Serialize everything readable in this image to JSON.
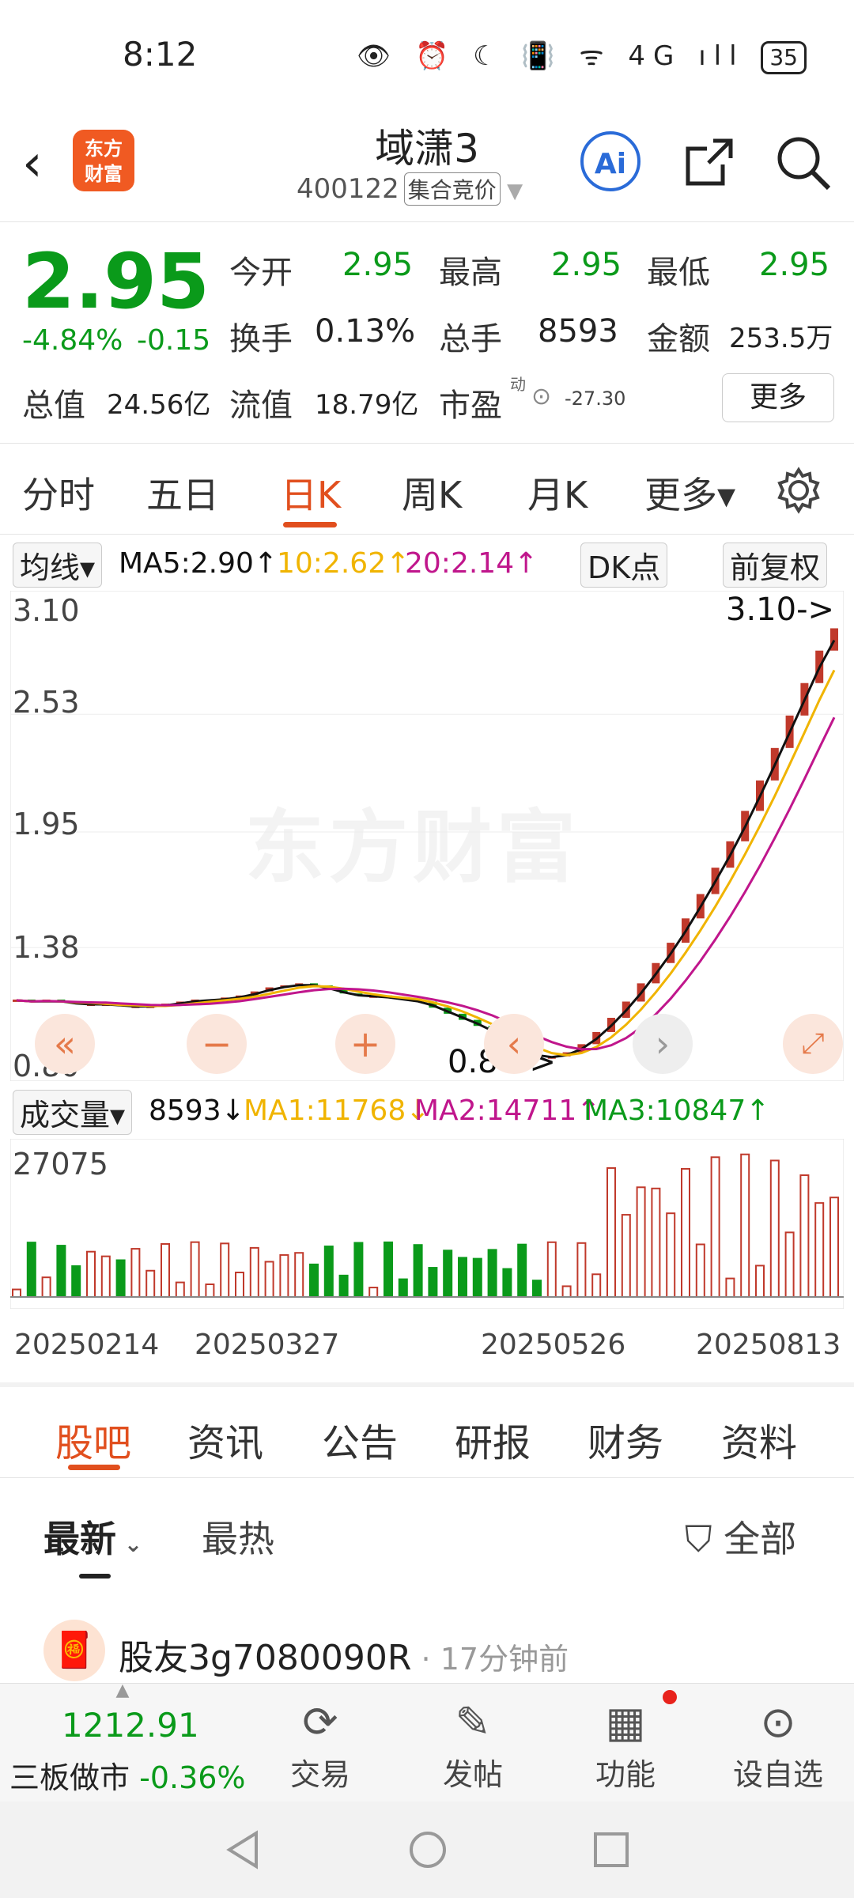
{
  "status": {
    "time": "8:12",
    "icons": "👁 ⏰ ☾ 📳 ᯤ 4G ıll",
    "battery": "35"
  },
  "header": {
    "stock_name": "域潇3",
    "stock_code": "400122",
    "auction_tag": "集合竞价"
  },
  "quote": {
    "price": "2.95",
    "change_pct": "-4.84%",
    "change_amt": "-0.15",
    "open_label": "今开",
    "open": "2.95",
    "high_label": "最高",
    "high": "2.95",
    "low_label": "最低",
    "low": "2.95",
    "turnover_label": "换手",
    "turnover": "0.13%",
    "volume_label": "总手",
    "volume": "8593",
    "amount_label": "金额",
    "amount": "253.5万",
    "total_value_label": "总值",
    "total_value": "24.56亿",
    "float_value_label": "流值",
    "float_value": "18.79亿",
    "pe_label": "市盈",
    "pe_sup": "动",
    "pe": "-27.30",
    "more": "更多"
  },
  "ktabs": [
    "分时",
    "五日",
    "日K",
    "周K",
    "月K",
    "更多▾"
  ],
  "ktab_active": "日K",
  "ma_row": {
    "selector": "均线▾",
    "ma5": "MA5:2.90↑",
    "ma10": "10:2.62↑",
    "ma20": "20:2.14↑",
    "dk": "DK点",
    "adjust": "前复权"
  },
  "price_axis": [
    "3.10",
    "2.53",
    "1.95",
    "1.38",
    "0.80"
  ],
  "annotations": {
    "high": "3.10->",
    "low": "0.80->"
  },
  "watermark": "东方财富",
  "volume_row": {
    "selector": "成交量▾",
    "vol": "8593↓",
    "ma1": "MA1:11768↓",
    "ma2": "MA2:14711↑",
    "ma3": "MA3:10847↑",
    "max": "27075"
  },
  "dates": [
    "20250214",
    "20250327",
    "20250526",
    "20250813"
  ],
  "bottom_tabs": [
    "股吧",
    "资讯",
    "公告",
    "研报",
    "财务",
    "资料"
  ],
  "sub_tabs": {
    "latest": "最新",
    "hot": "最热",
    "filter": "全部"
  },
  "post": {
    "user": "股友3g7080090R",
    "time": "17分钟前"
  },
  "bottom_bar": {
    "index_value": "1212.91",
    "index_name": "三板做市",
    "index_change": "-0.36%",
    "trade": "交易",
    "post": "发帖",
    "func": "功能",
    "watch": "设自选"
  },
  "colors": {
    "up": "#c0392b",
    "down": "#0a9a1a",
    "accent": "#e14f1e",
    "ma5": "#111111",
    "ma10": "#f0b400",
    "ma20": "#c0168c"
  },
  "chart_data": {
    "type": "candlestick",
    "price_range": [
      0.8,
      3.1
    ],
    "ma_current": {
      "MA5": 2.9,
      "MA10": 2.62,
      "MA20": 2.14
    },
    "close_series": [
      1.12,
      1.11,
      1.12,
      1.11,
      1.1,
      1.1,
      1.1,
      1.09,
      1.09,
      1.09,
      1.1,
      1.11,
      1.12,
      1.12,
      1.13,
      1.14,
      1.16,
      1.18,
      1.19,
      1.2,
      1.19,
      1.17,
      1.15,
      1.14,
      1.14,
      1.13,
      1.12,
      1.11,
      1.08,
      1.05,
      1.02,
      0.99,
      0.95,
      0.9,
      0.86,
      0.84,
      0.84,
      0.86,
      0.9,
      0.96,
      1.03,
      1.11,
      1.2,
      1.3,
      1.4,
      1.52,
      1.64,
      1.77,
      1.9,
      2.05,
      2.2,
      2.36,
      2.52,
      2.68,
      2.84,
      2.95
    ],
    "volume_max": 27075,
    "volume_last": 8593,
    "volume_ma": {
      "MA1": 11768,
      "MA2": 14711,
      "MA3": 10847
    }
  }
}
